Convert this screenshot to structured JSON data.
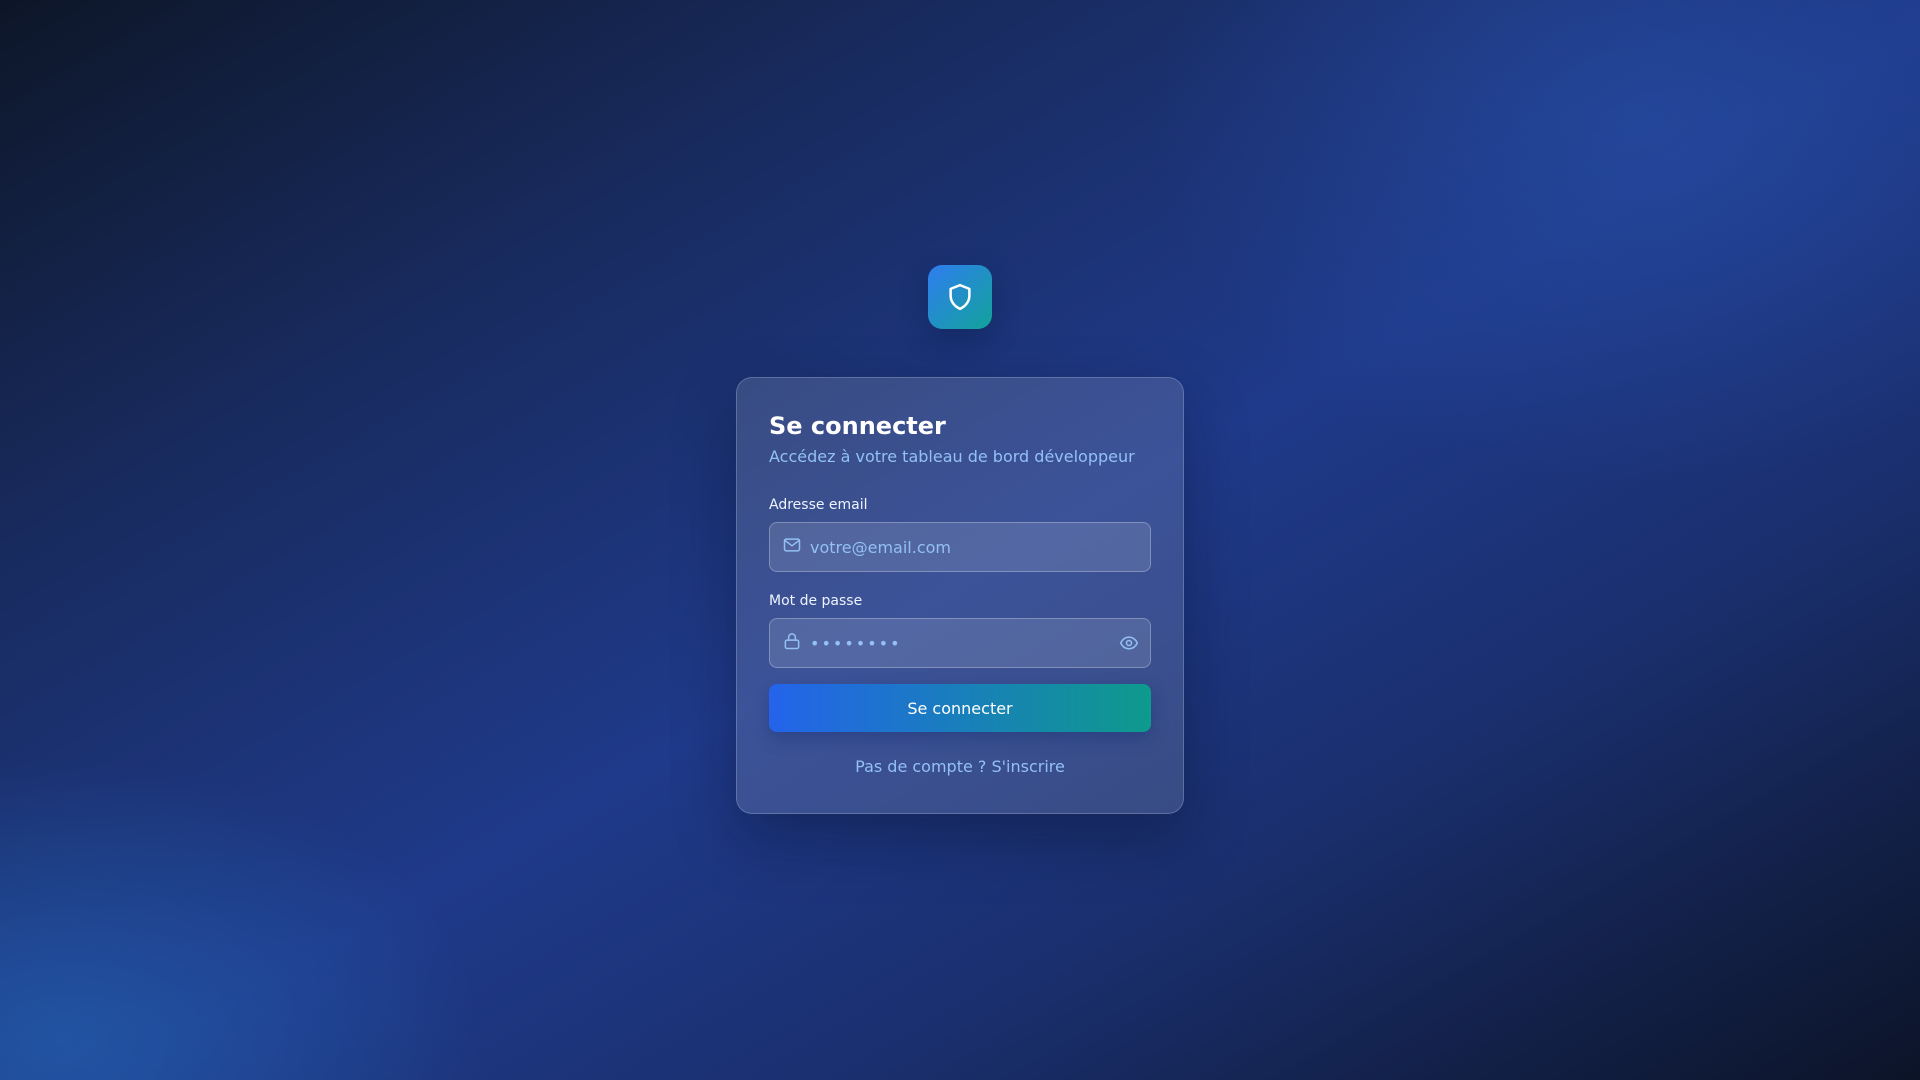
{
  "logo": {
    "icon": "shield-icon"
  },
  "login": {
    "title": "Se connecter",
    "subtitle": "Accédez à votre tableau de bord développeur",
    "email": {
      "label": "Adresse email",
      "placeholder": "votre@email.com",
      "value": "",
      "icon": "mail-icon"
    },
    "password": {
      "label": "Mot de passe",
      "placeholder": "••••••••",
      "value": "",
      "icon": "lock-icon",
      "toggle_icon": "eye-icon"
    },
    "submit_label": "Se connecter",
    "signup_text": "Pas de compte ? S'inscrire"
  },
  "colors": {
    "accent_start": "#2463eb",
    "accent_end": "#0e9a8c",
    "subtitle_text": "#93c0f5",
    "title_text": "#ffffff"
  }
}
